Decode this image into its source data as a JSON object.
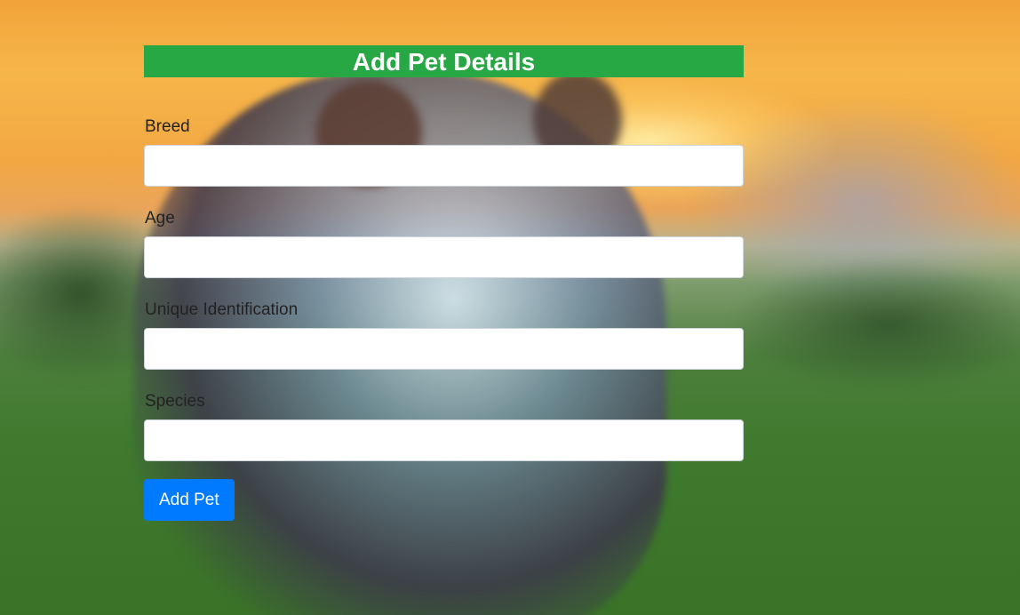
{
  "form": {
    "title": "Add Pet Details",
    "fields": [
      {
        "label": "Breed",
        "value": "",
        "placeholder": ""
      },
      {
        "label": "Age",
        "value": "",
        "placeholder": ""
      },
      {
        "label": "Unique Identification",
        "value": "",
        "placeholder": ""
      },
      {
        "label": "Species",
        "value": "",
        "placeholder": ""
      }
    ],
    "submit_label": "Add Pet"
  },
  "colors": {
    "title_bar": "#28a745",
    "button": "#007bff"
  }
}
